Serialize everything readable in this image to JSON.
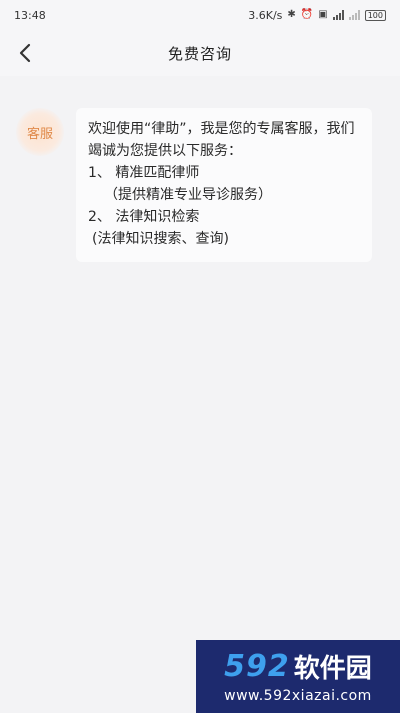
{
  "status_bar": {
    "time": "13:48",
    "net_speed": "3.6K/s",
    "battery": "100"
  },
  "header": {
    "title": "免费咨询"
  },
  "chat": {
    "sender_label": "客服",
    "message": {
      "intro": "欢迎使用“律助”，我是您的专属客服，我们竭诚为您提供以下服务：",
      "item1": "1、 精准匹配律师",
      "item1_desc": "（提供精准专业导诊服务）",
      "item2": "2、 法律知识检索",
      "item2_desc": "(法律知识搜索、查询)"
    }
  },
  "watermark": {
    "number": "592",
    "brand": "软件园",
    "url": "www.592xiazai.com"
  }
}
